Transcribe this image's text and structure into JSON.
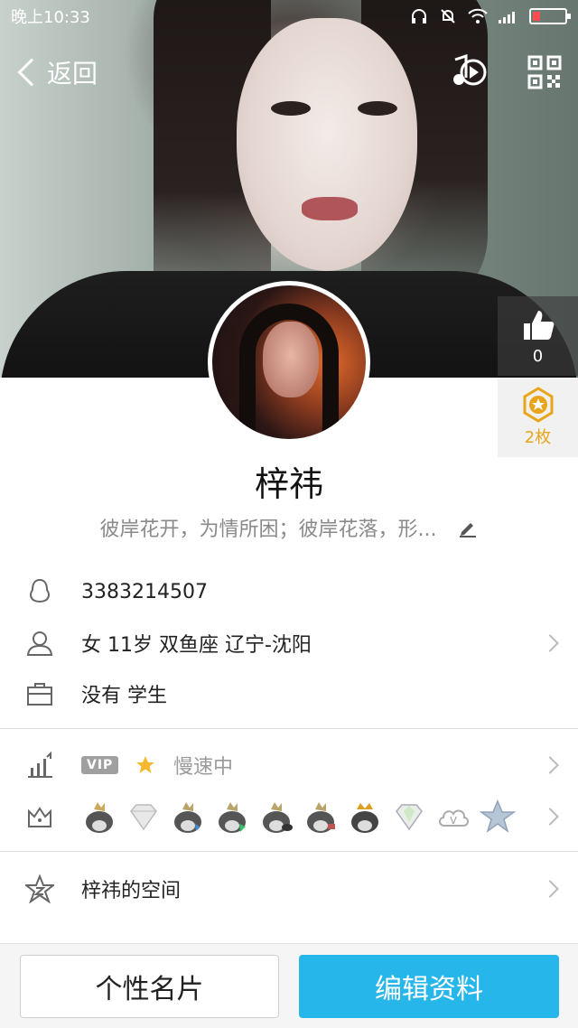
{
  "status_bar": {
    "time": "晚上10:33"
  },
  "nav": {
    "back_label": "返回"
  },
  "likes": {
    "count": "0"
  },
  "medals": {
    "count": "2枚"
  },
  "profile": {
    "name": "梓祎",
    "signature": "彼岸花开，为情所困；彼岸花落，形...",
    "qq_number": "3383214507",
    "basic_info": "女  11岁  双鱼座  辽宁-沈阳",
    "job_info": "没有 学生",
    "vip_label": "VIP",
    "speed_status": "慢速中",
    "space_label": "梓祎的空间"
  },
  "badges": [
    "qq-penguin-gold-icon",
    "diamond-icon",
    "qq-penguin-blue-icon",
    "qq-penguin-green-icon",
    "qq-penguin-dark-icon",
    "qq-penguin-pink-icon",
    "qq-penguin-crown-icon",
    "diamond-green-icon",
    "cloud-v-icon",
    "star-blue-icon"
  ],
  "buttons": {
    "card": "个性名片",
    "edit": "编辑资料"
  },
  "colors": {
    "accent": "#27b6ea",
    "medal": "#e9a51a"
  }
}
